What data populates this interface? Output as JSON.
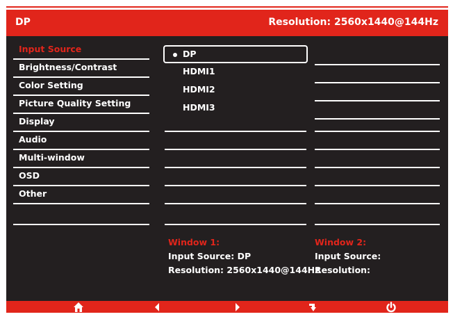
{
  "header": {
    "source": "DP",
    "resolution": "Resolution: 2560x1440@144Hz"
  },
  "menu": {
    "items": [
      {
        "label": "Input Source"
      },
      {
        "label": "Brightness/Contrast"
      },
      {
        "label": "Color Setting"
      },
      {
        "label": "Picture Quality Setting"
      },
      {
        "label": "Display"
      },
      {
        "label": "Audio"
      },
      {
        "label": "Multi-window"
      },
      {
        "label": "OSD"
      },
      {
        "label": "Other"
      }
    ]
  },
  "sources": {
    "items": [
      {
        "label": "DP"
      },
      {
        "label": "HDMI1"
      },
      {
        "label": "HDMI2"
      },
      {
        "label": "HDMI3"
      }
    ]
  },
  "window1": {
    "title": "Window 1:",
    "input": "Input Source: DP",
    "resolution": "Resolution: 2560x1440@144Hz"
  },
  "window2": {
    "title": "Window 2:",
    "input": "Input Source:",
    "resolution": "Resolution:"
  },
  "footer": {
    "icons": [
      "home-icon",
      "left-arrow-icon",
      "right-arrow-icon",
      "enter-icon",
      "power-icon"
    ]
  },
  "colors": {
    "accent": "#e1251b",
    "background": "#231f20",
    "text": "#ffffff"
  }
}
